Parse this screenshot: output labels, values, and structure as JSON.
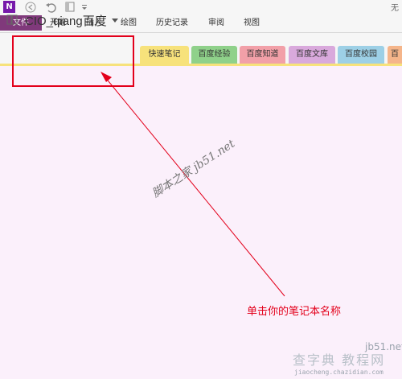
{
  "quick_access": {
    "logo": "N",
    "icons": [
      "onenote-logo-icon",
      "back-icon",
      "undo-icon",
      "dock-icon",
      "customize-dropdown-icon"
    ],
    "window_title_fragment": "无"
  },
  "ribbon": {
    "tabs": [
      "文件",
      "开始",
      "插入",
      "绘图",
      "历史记录",
      "审阅",
      "视图"
    ],
    "file_color": "#80397b"
  },
  "notebook": {
    "name": "CIO_qiang百度"
  },
  "sections": [
    {
      "label": "快速笔记",
      "color": "#f7e27b"
    },
    {
      "label": "百度经验",
      "color": "#8fd18a"
    },
    {
      "label": "百度知道",
      "color": "#f2a0a8"
    },
    {
      "label": "百度文库",
      "color": "#d9a9dc"
    },
    {
      "label": "百度校园",
      "color": "#9dd0e6"
    },
    {
      "label": "百",
      "color": "#f5b58a"
    }
  ],
  "overlay": {
    "watermark": "脚本之家 jb51.net",
    "annotation": "单击你的笔记本名称",
    "annotation_color": "#e3001b",
    "corner_watermark": {
      "site": "jb51.net",
      "text": "查字典 教程网",
      "url": "jiaocheng.chazidian.com"
    }
  }
}
